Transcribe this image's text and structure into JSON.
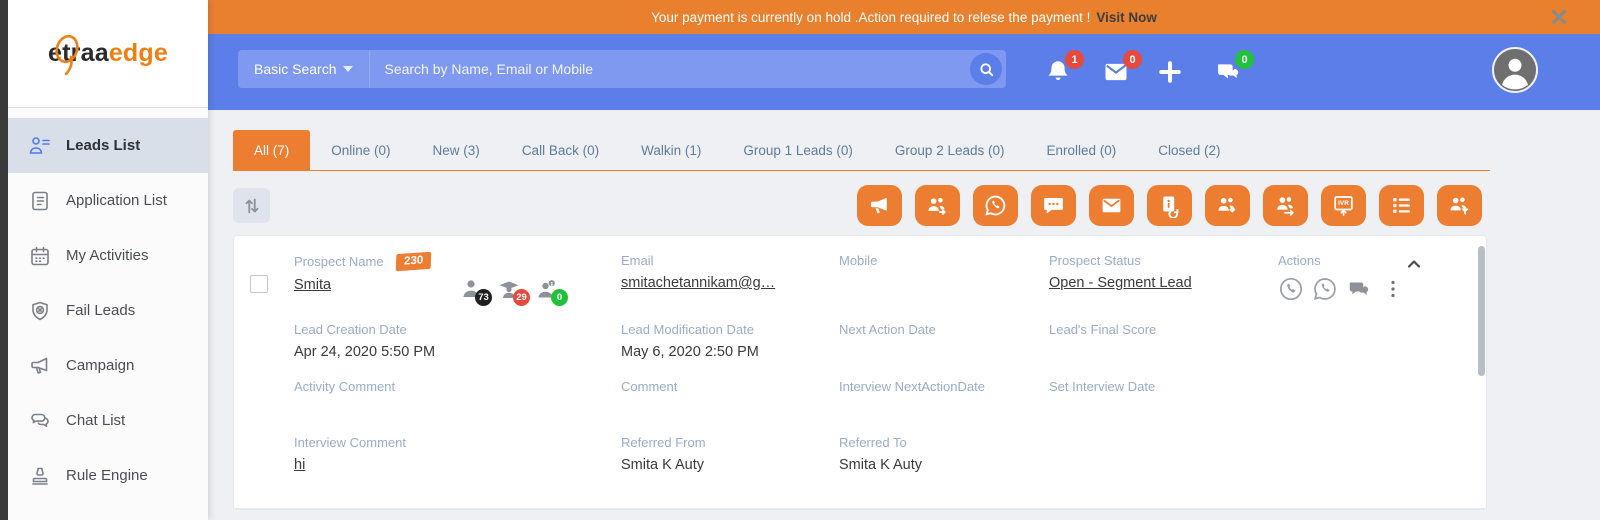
{
  "banner": {
    "message": "Your payment is currently on hold .Action required to relese the payment !",
    "link_label": "Visit Now",
    "close_icon": "x-icon"
  },
  "logo": {
    "part_dark": "traa",
    "part_orange": "edge",
    "letter": "e"
  },
  "header": {
    "search_mode_label": "Basic Search",
    "search_placeholder": "Search by Name, Email or Mobile",
    "search_value": "",
    "notifications_badge": "1",
    "messages_badge": "0",
    "chat_badge": "0",
    "icons": [
      "bell-icon",
      "mail-icon",
      "plus-icon",
      "chat-bubbles-icon",
      "avatar"
    ]
  },
  "sidebar": {
    "items": [
      {
        "label": "Leads List",
        "icon": "leads-list-icon",
        "active": true
      },
      {
        "label": "Application List",
        "icon": "application-list-icon",
        "active": false
      },
      {
        "label": "My Activities",
        "icon": "calendar-icon",
        "active": false
      },
      {
        "label": "Fail Leads",
        "icon": "shield-fail-icon",
        "active": false
      },
      {
        "label": "Campaign",
        "icon": "megaphone-icon",
        "active": false
      },
      {
        "label": "Chat List",
        "icon": "chat-bubbles-icon",
        "active": false
      },
      {
        "label": "Rule Engine",
        "icon": "stamp-icon",
        "active": false
      }
    ]
  },
  "tabs": [
    {
      "label": "All (7)",
      "active": true
    },
    {
      "label": "Online (0)",
      "active": false
    },
    {
      "label": "New (3)",
      "active": false
    },
    {
      "label": "Call Back (0)",
      "active": false
    },
    {
      "label": "Walkin (1)",
      "active": false
    },
    {
      "label": "Group 1 Leads (0)",
      "active": false
    },
    {
      "label": "Group 2 Leads (0)",
      "active": false
    },
    {
      "label": "Enrolled (0)",
      "active": false
    },
    {
      "label": "Closed (2)",
      "active": false
    }
  ],
  "toolbar": {
    "sort_icon": "sort-arrows-icon",
    "action_icons": [
      "megaphone",
      "users-share",
      "whatsapp",
      "sms",
      "email",
      "contact-sync",
      "users-download",
      "users-transfer",
      "ivr-push",
      "list-view",
      "users-filter"
    ]
  },
  "lead": {
    "prospect_name_label": "Prospect Name",
    "flag_badge": "230",
    "name": "Smita",
    "stats": [
      {
        "icon": "person-icon",
        "count": "73",
        "color": "black"
      },
      {
        "icon": "graduate-icon",
        "count": "29",
        "color": "red"
      },
      {
        "icon": "info-person-icon",
        "count": "0",
        "color": "green"
      }
    ],
    "email_label": "Email",
    "email": "smitachetannikam@g…",
    "mobile_label": "Mobile",
    "mobile": "",
    "status_label": "Prospect Status",
    "status": "Open - Segment Lead",
    "actions_label": "Actions",
    "action_icons": [
      "phone-icon",
      "whatsapp-icon",
      "chat-icon",
      "kebab-icon"
    ],
    "creation_label": "Lead Creation Date",
    "creation": "Apr 24, 2020 5:50 PM",
    "modification_label": "Lead Modification Date",
    "modification": "May 6, 2020 2:50 PM",
    "next_action_label": "Next Action Date",
    "next_action": "",
    "final_score_label": "Lead's Final Score",
    "final_score": "",
    "activity_comment_label": "Activity Comment",
    "activity_comment": "",
    "comment_label": "Comment",
    "comment": "",
    "interview_nad_label": "Interview NextActionDate",
    "interview_nad": "",
    "set_interview_label": "Set Interview Date",
    "set_interview": "",
    "interview_comment_label": "Interview Comment",
    "interview_comment": "hi",
    "referred_from_label": "Referred From",
    "referred_from": "Smita K Auty",
    "referred_to_label": "Referred To",
    "referred_to": "Smita K Auty"
  },
  "colors": {
    "accent_orange": "#ED7D31",
    "banner_orange": "#E8802E",
    "header_blue": "#5B7EE8",
    "search_blue": "#7E99EF",
    "badge_red": "#E74A3C",
    "badge_green": "#22C13B",
    "badge_black": "#1F1F1F",
    "sidebar_active_bg": "#D8DFE8",
    "label_blue_gray": "#9AACC8"
  }
}
